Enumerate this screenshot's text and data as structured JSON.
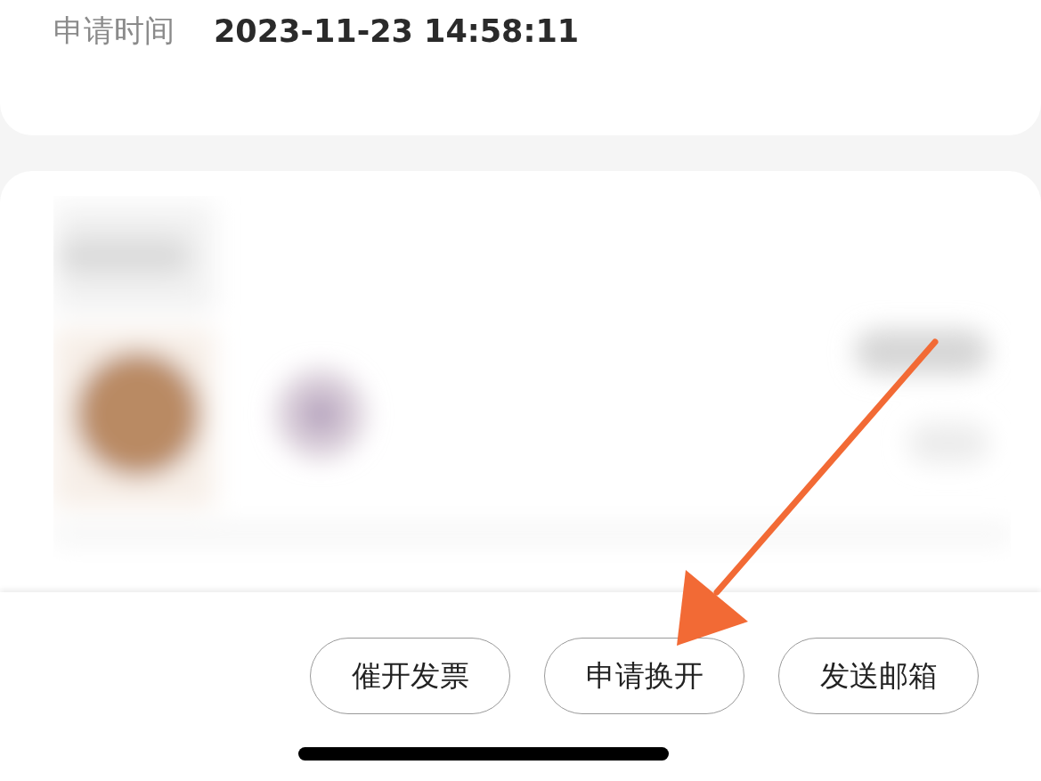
{
  "apply_info": {
    "label": "申请时间",
    "value": "2023-11-23 14:58:11"
  },
  "buttons": [
    {
      "label": "催开发票"
    },
    {
      "label": "申请换开"
    },
    {
      "label": "发送邮箱"
    }
  ]
}
